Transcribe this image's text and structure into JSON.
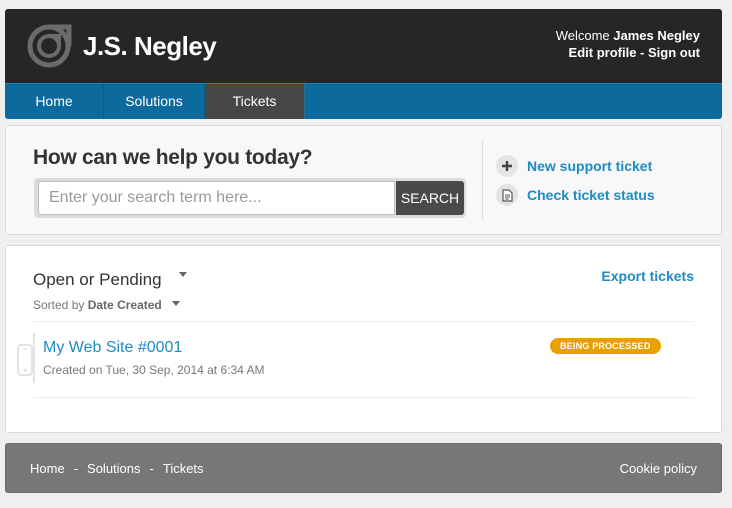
{
  "header": {
    "brand": "J.S. Negley",
    "welcome_prefix": "Welcome",
    "user_name": "James Negley",
    "edit_profile": "Edit profile",
    "link_separator": " - ",
    "sign_out": "Sign out"
  },
  "nav": {
    "items": [
      {
        "label": "Home"
      },
      {
        "label": "Solutions"
      },
      {
        "label": "Tickets",
        "active": true
      }
    ]
  },
  "search": {
    "title": "How can we help you today?",
    "placeholder": "Enter your search term here...",
    "button_label": "SEARCH"
  },
  "actions": {
    "new_ticket": "New support ticket",
    "check_status": "Check ticket status"
  },
  "tickets": {
    "filter_label": "Open or Pending",
    "sorted_prefix": "Sorted by",
    "sorted_by": "Date Created",
    "export_label": "Export tickets",
    "list": [
      {
        "title": "My Web Site #0001",
        "created": "Created on Tue, 30 Sep, 2014 at 6:34 AM",
        "status": "BEING PROCESSED"
      }
    ]
  },
  "footer": {
    "links": [
      {
        "label": "Home"
      },
      {
        "label": "Solutions"
      },
      {
        "label": "Tickets"
      }
    ],
    "separator": "-",
    "cookie_policy": "Cookie policy"
  },
  "colors": {
    "header_bg": "#262626",
    "nav_bg": "#0d6a9d",
    "nav_active_bg": "#474747",
    "link_blue": "#1e8bc3",
    "badge_orange": "#e8a000",
    "footer_bg": "#777777"
  },
  "icons": {
    "logo": "brand-logo",
    "new_ticket": "plus-icon",
    "check_status": "document-icon",
    "filter": "caret-down-icon",
    "sort": "caret-down-icon",
    "ticket_source": "phone-icon"
  }
}
